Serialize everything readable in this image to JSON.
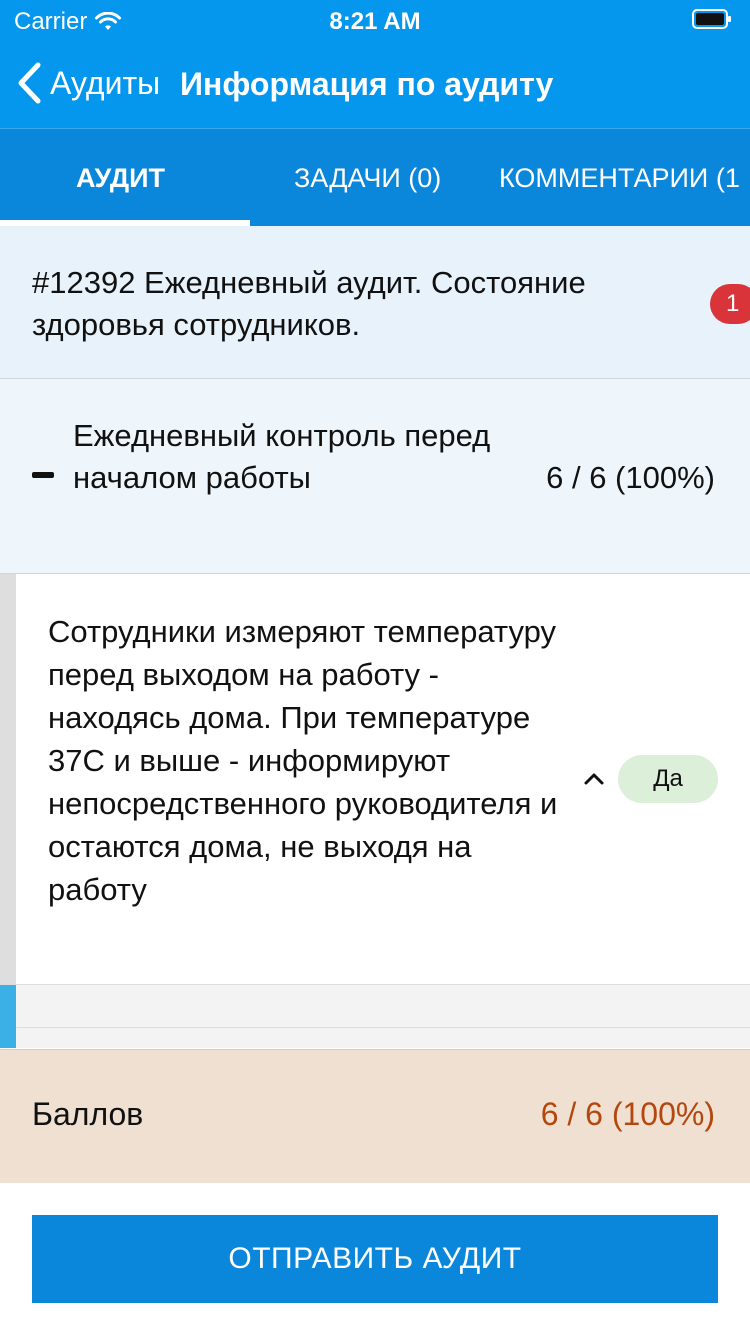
{
  "status_bar": {
    "carrier": "Carrier",
    "time": "8:21 AM"
  },
  "navbar": {
    "back_label": "Аудиты",
    "title": "Информация по аудиту"
  },
  "tabs": [
    {
      "label": "АУДИТ",
      "active": true
    },
    {
      "label": "ЗАДАЧИ (0)",
      "active": false
    },
    {
      "label": "КОММЕНТАРИИ (1",
      "active": false
    }
  ],
  "audit": {
    "title": "#12392 Ежедневный аудит. Состояние здоровья сотрудников.",
    "badge": "1"
  },
  "section": {
    "title": "Ежедневный контроль перед началом работы",
    "score": "6 / 6 (100%)"
  },
  "question": {
    "text": "Сотрудники измеряют температуру перед выходом на работу - находясь дома. При температуре 37С и выше - информируют непосредственного руководителя и остаются дома, не выходя на работу",
    "answer": "Да"
  },
  "score_bar": {
    "label": "Баллов",
    "value": "6 / 6 (100%)"
  },
  "footer": {
    "submit_label": "ОТПРАВИТЬ АУДИТ"
  },
  "colors": {
    "primary": "#0596ee",
    "tab_bar": "#0a86da",
    "badge": "#d9343a",
    "answer_pill": "#dcefd9",
    "score_value": "#b4470e",
    "score_bar_bg": "#efe0d2"
  }
}
